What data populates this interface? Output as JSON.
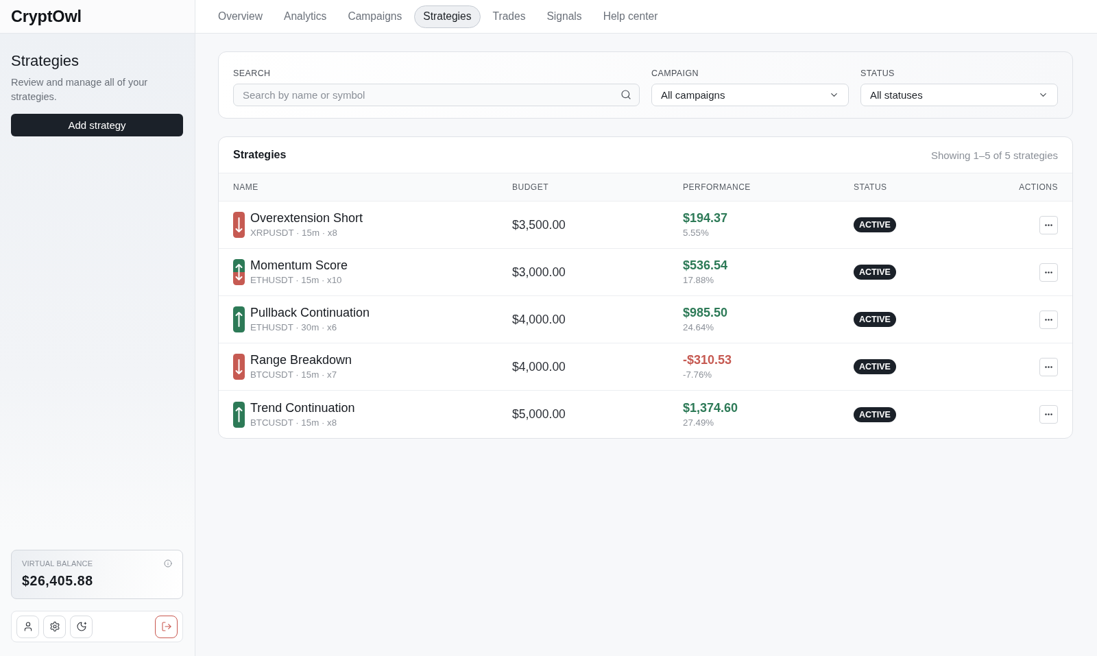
{
  "logo": {
    "text": "CryptOwl"
  },
  "nav": {
    "tabs": [
      {
        "label": "Overview",
        "selected": false
      },
      {
        "label": "Analytics",
        "selected": false
      },
      {
        "label": "Campaigns",
        "selected": false
      },
      {
        "label": "Strategies",
        "selected": true
      },
      {
        "label": "Trades",
        "selected": false
      },
      {
        "label": "Signals",
        "selected": false
      },
      {
        "label": "Help center",
        "selected": false
      }
    ]
  },
  "sidebar": {
    "title": "Strategies",
    "description": "Review and manage all of your strategies.",
    "add_button": "Add strategy",
    "balance": {
      "label": "VIRTUAL BALANCE",
      "value": "$26,405.88"
    }
  },
  "filters": {
    "search": {
      "label": "SEARCH",
      "placeholder": "Search by name or symbol"
    },
    "campaign": {
      "label": "CAMPAIGN",
      "value": "All campaigns"
    },
    "status": {
      "label": "STATUS",
      "value": "All statuses"
    }
  },
  "strategies": {
    "title": "Strategies",
    "summary": "Showing 1–5 of 5 strategies",
    "columns": [
      "NAME",
      "BUDGET",
      "PERFORMANCE",
      "STATUS",
      "ACTIONS"
    ],
    "rows": [
      {
        "kind": "short",
        "name": "Overextension Short",
        "details": "XRPUSDT · 15m · x8",
        "budget": "$3,500.00",
        "pnl": "$194.37",
        "pnl_percent": "5.55%",
        "positive": true,
        "status": "ACTIVE"
      },
      {
        "kind": "both",
        "name": "Momentum Score",
        "details": "ETHUSDT · 15m · x10",
        "budget": "$3,000.00",
        "pnl": "$536.54",
        "pnl_percent": "17.88%",
        "positive": true,
        "status": "ACTIVE"
      },
      {
        "kind": "long",
        "name": "Pullback Continuation",
        "details": "ETHUSDT · 30m · x6",
        "budget": "$4,000.00",
        "pnl": "$985.50",
        "pnl_percent": "24.64%",
        "positive": true,
        "status": "ACTIVE"
      },
      {
        "kind": "short",
        "name": "Range Breakdown",
        "details": "BTCUSDT · 15m · x7",
        "budget": "$4,000.00",
        "pnl": "-$310.53",
        "pnl_percent": "-7.76%",
        "positive": false,
        "status": "ACTIVE"
      },
      {
        "kind": "long",
        "name": "Trend Continuation",
        "details": "BTCUSDT · 15m · x8",
        "budget": "$5,000.00",
        "pnl": "$1,374.60",
        "pnl_percent": "27.49%",
        "positive": true,
        "status": "ACTIVE"
      }
    ]
  }
}
